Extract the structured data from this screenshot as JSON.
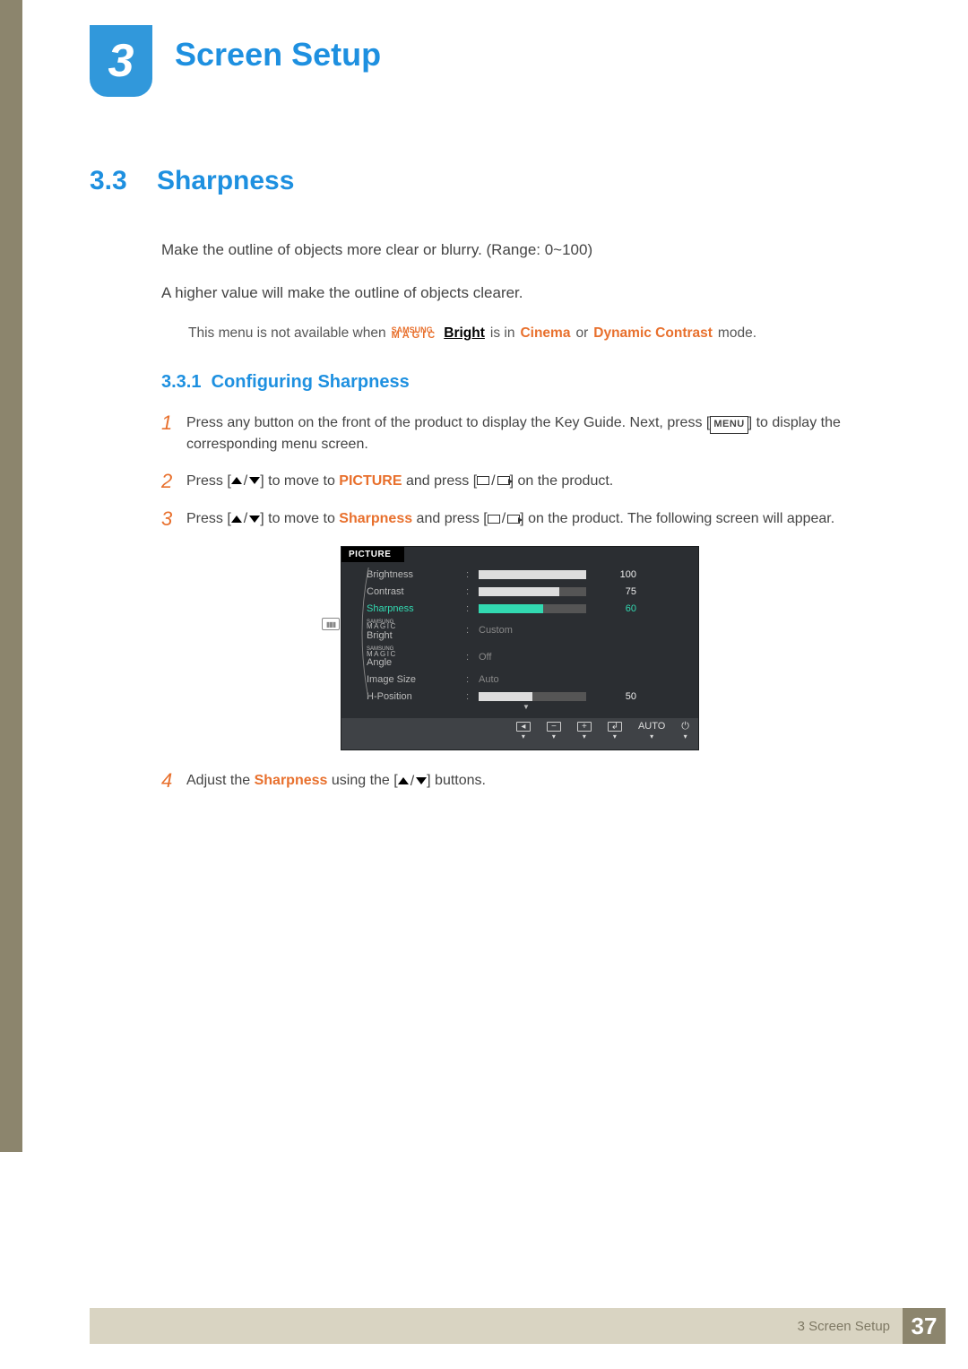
{
  "chapter": {
    "number": "3",
    "title": "Screen Setup"
  },
  "section": {
    "number": "3.3",
    "title": "Sharpness"
  },
  "intro": {
    "p1": "Make the outline of objects more clear or blurry. (Range: 0~100)",
    "p2": "A higher value will make the outline of objects clearer."
  },
  "note": {
    "pre": "This menu is not available when ",
    "magic_top": "SAMSUNG",
    "magic_bot": "MAGIC",
    "bright": "Bright",
    "mid": " is in ",
    "cinema": "Cinema",
    "or": " or ",
    "dynamic": "Dynamic Contrast",
    "post": " mode."
  },
  "subsection": {
    "number": "3.3.1",
    "title": "Configuring Sharpness"
  },
  "steps": {
    "s1": {
      "num": "1",
      "a": "Press any button on the front of the product to display the Key Guide. Next, press [",
      "menu": "MENU",
      "b": "] to display the corresponding menu screen."
    },
    "s2": {
      "num": "2",
      "a": "Press [",
      "b": "] to move to ",
      "picture": "PICTURE",
      "c": " and press [",
      "d": "] on the product."
    },
    "s3": {
      "num": "3",
      "a": "Press [",
      "b": "] to move to ",
      "sharp": "Sharpness",
      "c": " and press [",
      "d": "] on the product. The following screen will appear."
    },
    "s4": {
      "num": "4",
      "a": "Adjust the ",
      "sharp": "Sharpness",
      "b": " using the [",
      "c": "] buttons."
    }
  },
  "osd": {
    "title": "PICTURE",
    "rows": {
      "brightness": {
        "label": "Brightness",
        "value": "100",
        "fill": 100
      },
      "contrast": {
        "label": "Contrast",
        "value": "75",
        "fill": 75
      },
      "sharpness": {
        "label": "Sharpness",
        "value": "60",
        "fill": 60
      },
      "magicbright": {
        "label_top": "SAMSUNG",
        "label_bot": "MAGIC",
        "label_suffix": " Bright",
        "value": "Custom"
      },
      "magicangle": {
        "label_top": "SAMSUNG",
        "label_bot": "MAGIC",
        "label_suffix": " Angle",
        "value": "Off"
      },
      "imagesize": {
        "label": "Image Size",
        "value": "Auto"
      },
      "hposition": {
        "label": "H-Position",
        "value": "50",
        "fill": 50
      }
    },
    "footer": {
      "auto": "AUTO"
    }
  },
  "footer": {
    "text": "3 Screen Setup",
    "page": "37"
  }
}
